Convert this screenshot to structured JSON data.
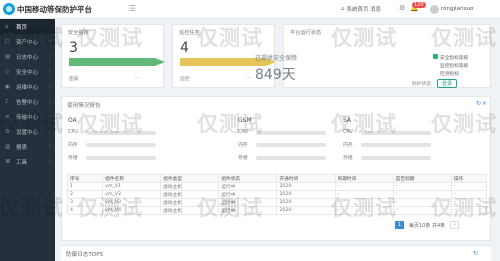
{
  "header": {
    "brand": "中国移动等保防护平台",
    "home": "系统首页",
    "message": "消息",
    "alert_count": "120",
    "user": "rongjiarisuo"
  },
  "sidebar": [
    {
      "icon": "home-icon",
      "label": "首页"
    },
    {
      "icon": "asset-icon",
      "label": "资产中心"
    },
    {
      "icon": "log-icon",
      "label": "日志中心"
    },
    {
      "icon": "security-icon",
      "label": "安全中心"
    },
    {
      "icon": "eye-icon",
      "label": "运维中心"
    },
    {
      "icon": "bell-icon",
      "label": "告警中心"
    },
    {
      "icon": "stat-icon",
      "label": "传输中心"
    },
    {
      "icon": "settings-icon",
      "label": "设置中心"
    },
    {
      "icon": "chart-icon",
      "label": "报表"
    },
    {
      "icon": "tool-icon",
      "label": "工具"
    }
  ],
  "cards": {
    "card1": {
      "title": "安全指标",
      "value": "3",
      "foot1": "图表",
      "foot2": "..."
    },
    "card2": {
      "title": "巡检任务",
      "value": "4",
      "foot1": "监控",
      "foot2": "..."
    },
    "card3": {
      "title": "平台运行状态",
      "secure": "已提供安全保障",
      "days": "849天",
      "status": "防护状态",
      "button": "登录"
    },
    "right_legend": [
      "安全指标等级",
      "监控指标等级",
      "检测指标"
    ]
  },
  "section": {
    "title": "使用情况报告",
    "sys": [
      {
        "name": "OA",
        "cpu": "CPU",
        "mem": "内存",
        "disk": "存储"
      },
      {
        "name": "GSM",
        "cpu": "CPU",
        "mem": "内存",
        "disk": "存储"
      },
      {
        "name": "SA",
        "cpu": "CPU",
        "mem": "内存",
        "disk": "存储"
      }
    ],
    "table": {
      "headers": [
        "序号",
        "组件名称",
        "组件类型",
        "组件状态",
        "开通时间",
        "到期时间",
        "是否到期",
        "操作"
      ],
      "rows": [
        [
          "1",
          "vm_V1",
          "虚拟主机",
          "运行中",
          "2020-",
          "-",
          "-",
          "-"
        ],
        [
          "2",
          "vm_V2",
          "虚拟主机",
          "运行中",
          "2020-",
          "-",
          "-",
          "-"
        ],
        [
          "3",
          "vm_V3",
          "虚拟主机",
          "运行中",
          "2020-",
          "-",
          "-",
          "-"
        ],
        [
          "4",
          "vm_V4",
          "虚拟主机",
          "运行中",
          "2020-",
          "-",
          "-",
          "-"
        ]
      ]
    },
    "pagination": {
      "page": "1",
      "info": "每页10条 共4条"
    }
  },
  "footer": {
    "title": "防御日志TOP5"
  }
}
